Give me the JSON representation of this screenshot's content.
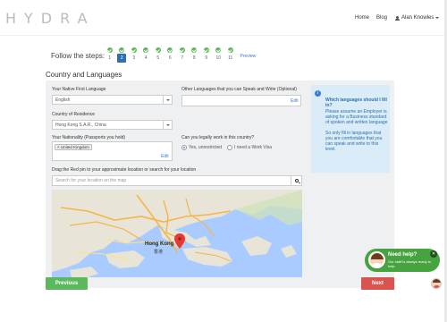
{
  "header": {
    "logo": "HYDRA",
    "nav": {
      "home": "Home",
      "blog": "Blog",
      "user": "Alan Knowles"
    }
  },
  "steps": {
    "label": "Follow the steps:",
    "items": [
      {
        "num": "1",
        "done": true
      },
      {
        "num": "2",
        "done": true,
        "active": true
      },
      {
        "num": "3",
        "done": true
      },
      {
        "num": "4",
        "done": true
      },
      {
        "num": "5",
        "done": true
      },
      {
        "num": "6",
        "done": true
      },
      {
        "num": "7",
        "done": true
      },
      {
        "num": "8",
        "done": true
      },
      {
        "num": "9",
        "done": true
      },
      {
        "num": "10",
        "done": true
      },
      {
        "num": "11",
        "done": true
      }
    ],
    "preview": "Preview"
  },
  "section": {
    "title": "Country and Languages"
  },
  "form": {
    "native_language": {
      "label": "Your Native First Language",
      "value": "English"
    },
    "other_languages": {
      "label": "Other Languages that you can Speak and Write (Optional)",
      "edit": "Edit"
    },
    "residence": {
      "label": "Country of Residence",
      "value": "Hong Kong S.A.R., China"
    },
    "nationality": {
      "label": "Your Nationality (Passports you hold)",
      "tag": "United Kingdom",
      "edit": "Edit"
    },
    "work": {
      "label": "Can you legally work in this country?",
      "option_yes": "Yes, unrestricted",
      "option_visa": "I need a Work Visa"
    },
    "location": {
      "label": "Drag the Red pin to your approximate location or search for your location",
      "placeholder": "Search for your location on the map"
    }
  },
  "info": {
    "icon": "i",
    "title": "Which languages should I fill in?",
    "body": "Please assume an Employer is asking for a Business standard of spoken and written language\n\nSo only fill in languages that you are comfortable that you can speak and write to this level."
  },
  "map": {
    "city": "Hong Kong",
    "city_local": "香港"
  },
  "buttons": {
    "previous": "Previous",
    "next": "Next"
  },
  "help": {
    "title": "Need help?",
    "subtitle": "Our staff is always ready to help",
    "close": "✕"
  }
}
